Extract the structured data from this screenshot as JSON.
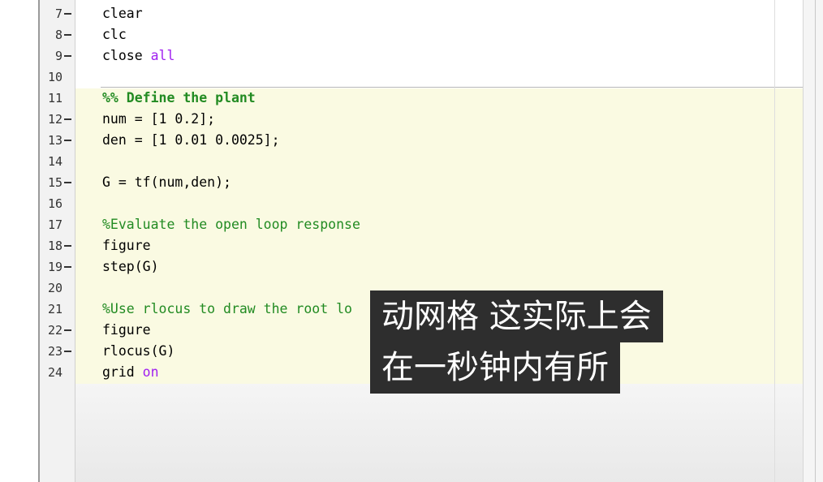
{
  "editor": {
    "lines": [
      {
        "num": "7",
        "has_dash": true,
        "tokens": [
          {
            "t": "clear",
            "c": "code"
          }
        ]
      },
      {
        "num": "8",
        "has_dash": true,
        "tokens": [
          {
            "t": "clc",
            "c": "code"
          }
        ]
      },
      {
        "num": "9",
        "has_dash": true,
        "tokens": [
          {
            "t": "close ",
            "c": "code"
          },
          {
            "t": "all",
            "c": "str"
          }
        ]
      },
      {
        "num": "10",
        "has_dash": false,
        "tokens": []
      },
      {
        "num": "11",
        "has_dash": false,
        "tokens": [
          {
            "t": "%% Define the plant",
            "c": "cell-title"
          }
        ]
      },
      {
        "num": "12",
        "has_dash": true,
        "tokens": [
          {
            "t": "num = [1 0.2];",
            "c": "code"
          }
        ]
      },
      {
        "num": "13",
        "has_dash": true,
        "tokens": [
          {
            "t": "den = [1 0.01 0.0025];",
            "c": "code"
          }
        ]
      },
      {
        "num": "14",
        "has_dash": false,
        "tokens": []
      },
      {
        "num": "15",
        "has_dash": true,
        "tokens": [
          {
            "t": "G = tf(num,den);",
            "c": "code"
          }
        ]
      },
      {
        "num": "16",
        "has_dash": false,
        "tokens": []
      },
      {
        "num": "17",
        "has_dash": false,
        "tokens": [
          {
            "t": "%Evaluate the open loop response",
            "c": "cmt"
          }
        ]
      },
      {
        "num": "18",
        "has_dash": true,
        "tokens": [
          {
            "t": "figure",
            "c": "code"
          }
        ]
      },
      {
        "num": "19",
        "has_dash": true,
        "tokens": [
          {
            "t": "step(G)",
            "c": "code"
          }
        ]
      },
      {
        "num": "20",
        "has_dash": false,
        "tokens": []
      },
      {
        "num": "21",
        "has_dash": false,
        "tokens": [
          {
            "t": "%Use rlocus to draw the root lo",
            "c": "cmt"
          }
        ]
      },
      {
        "num": "22",
        "has_dash": true,
        "tokens": [
          {
            "t": "figure",
            "c": "code"
          }
        ]
      },
      {
        "num": "23",
        "has_dash": true,
        "tokens": [
          {
            "t": "rlocus(G)",
            "c": "code"
          }
        ]
      },
      {
        "num": "24",
        "has_dash": false,
        "tokens": [
          {
            "t": "grid ",
            "c": "code"
          },
          {
            "t": "on",
            "c": "str"
          }
        ]
      }
    ]
  },
  "subtitles": {
    "line1": "动网格 这实际上会",
    "line2": "在一秒钟内有所"
  },
  "colors": {
    "keyword_string": "#a020f0",
    "comment": "#228b22",
    "cell_highlight": "#fafae2"
  }
}
